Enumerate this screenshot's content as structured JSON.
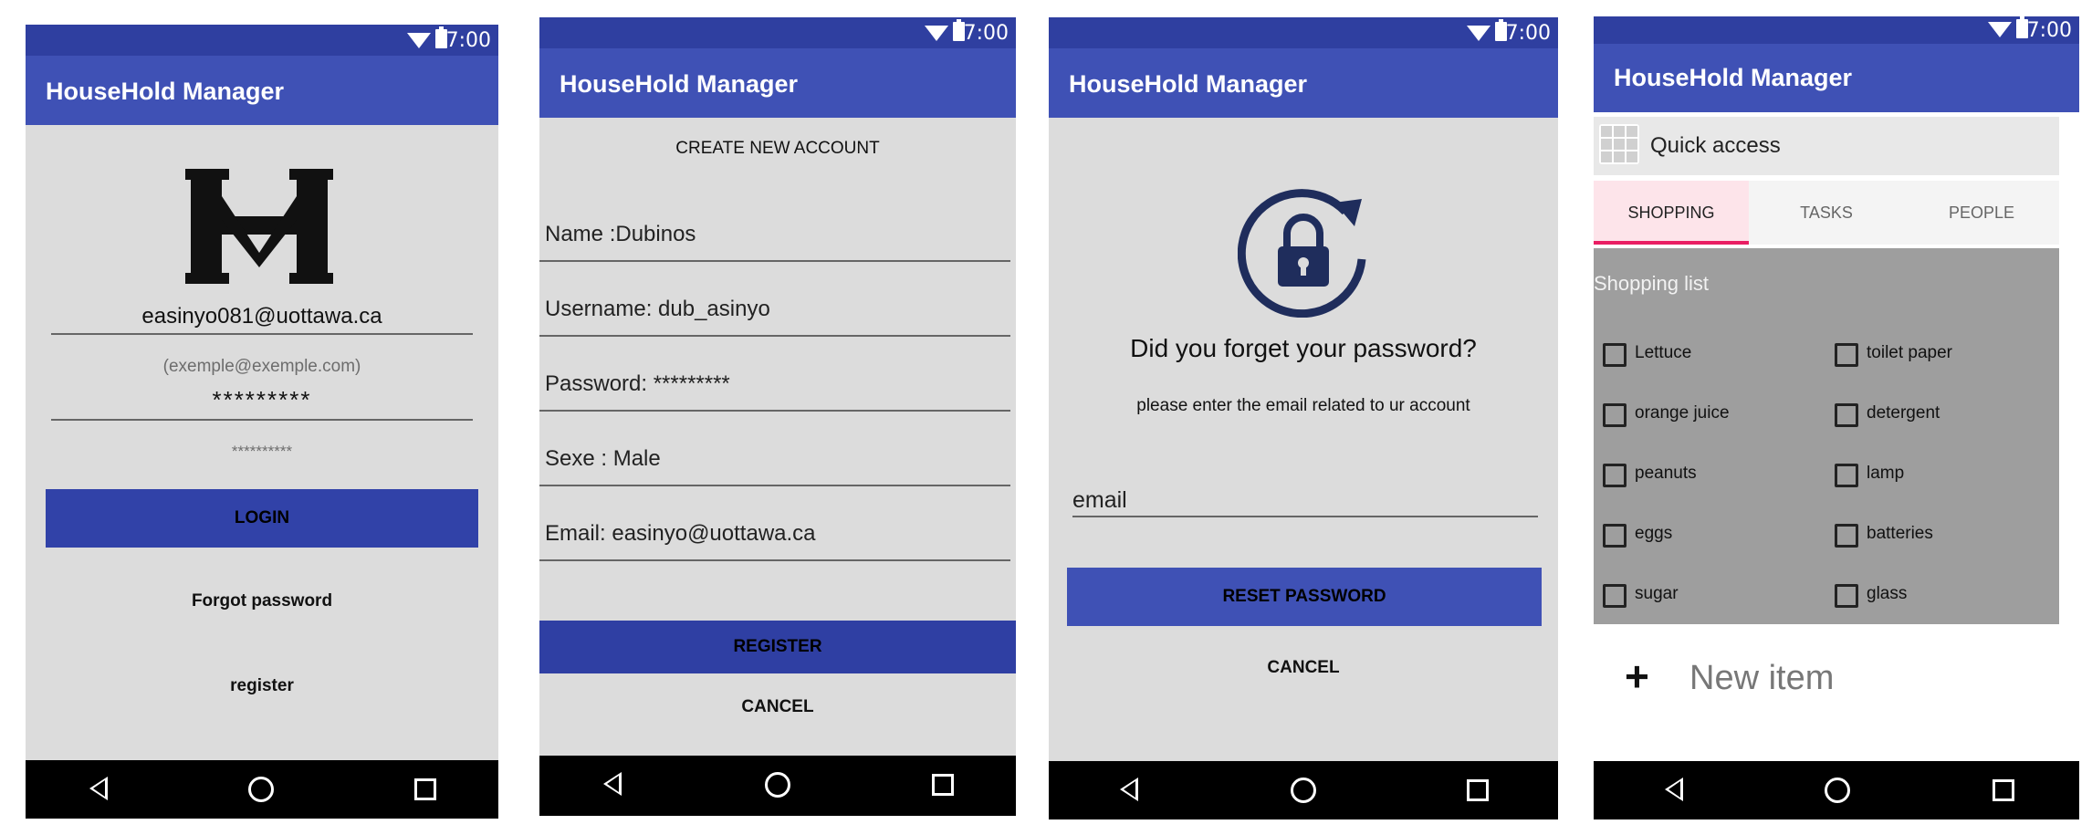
{
  "status": {
    "time": "7:00"
  },
  "app_title": "HouseHold Manager",
  "login": {
    "email_value": "easinyo081@uottawa.ca",
    "email_hint": "(exemple@exemple.com)",
    "password_value": "*********",
    "password_hint": "**********",
    "login_button": "LOGIN",
    "forgot_link": "Forgot password",
    "register_link": "register"
  },
  "register": {
    "heading": "CREATE NEW ACCOUNT",
    "fields": [
      "Name  :Dubinos",
      "Username: dub_asinyo",
      "Password: *********",
      "Sexe : Male",
      "Email: easinyo@uottawa.ca"
    ],
    "register_button": "REGISTER",
    "cancel_button": "CANCEL"
  },
  "forgot": {
    "heading": "Did you forget your password?",
    "instruction": "please enter the email related to ur account",
    "email_placeholder": "email",
    "reset_button": "RESET PASSWORD",
    "cancel_button": "CANCEL"
  },
  "household": {
    "quick_access": "Quick access",
    "tabs": [
      "SHOPPING",
      "TASKS",
      "PEOPLE"
    ],
    "list_title": "Shopping list",
    "items": [
      "Lettuce",
      "toilet paper",
      "orange juice",
      "detergent",
      "peanuts",
      "lamp",
      "eggs",
      "batteries",
      "sugar",
      "glass"
    ],
    "new_item": "New item"
  },
  "colors": {
    "appbar": "#3f51b5",
    "statusbar": "#2f3fa0",
    "button": "#3142a8",
    "active_tab_bg": "#fde4ea",
    "active_tab_underline": "#e91e63",
    "lock_icon": "#1f2d5c"
  }
}
